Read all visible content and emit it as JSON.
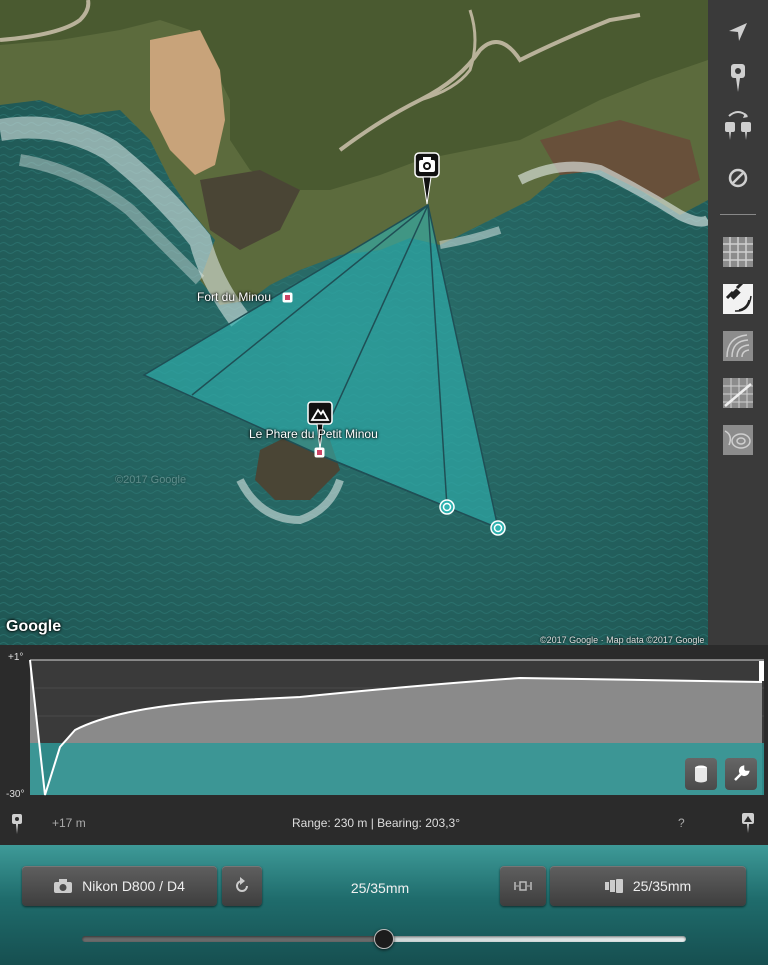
{
  "map": {
    "labels": {
      "fort": "Fort du Minou",
      "lighthouse": "Le Phare du Petit Minou",
      "watermark": "©2017 Google"
    },
    "logo": "Google",
    "attribution": "©2017 Google · Map data ©2017 Google",
    "markers": {
      "camera": "camera-icon",
      "subject": "mountain-icon",
      "focus_points": [
        "target-ring-icon",
        "target-ring-icon"
      ]
    },
    "colors": {
      "frustum": "#2fb2b0",
      "frustum_edge": "#1f4f55"
    }
  },
  "sidebar": {
    "items": [
      {
        "icon": "locate-arrow-icon"
      },
      {
        "icon": "pin-icon"
      },
      {
        "icon": "swap-pins-icon"
      },
      {
        "icon": "no-entry-icon"
      },
      {
        "icon": "grid-layer-icon"
      },
      {
        "icon": "satellite-layer-icon",
        "active": true
      },
      {
        "icon": "terrain-layer-icon"
      },
      {
        "icon": "hybrid-layer-icon"
      },
      {
        "icon": "topo-layer-icon"
      }
    ]
  },
  "profile": {
    "top_label": "+1°",
    "bottom_label": "-30°",
    "left_elevation": "+17 m",
    "range_bearing": "Range: 230 m | Bearing: 203,3°",
    "help": "?",
    "tools": [
      "cylinder-icon",
      "wrench-icon"
    ],
    "colors": {
      "band": "#2e9896",
      "fill": "#8a8a8a",
      "line": "#ffffff"
    }
  },
  "camera_bar": {
    "camera_button": "Nikon D800 / D4",
    "reset_icon": "rotate-icon",
    "focal_center": "25/35mm",
    "sensor_icon": "sensor-frame-icon",
    "lens_button": "25/35mm",
    "slider_value": 0.5
  }
}
